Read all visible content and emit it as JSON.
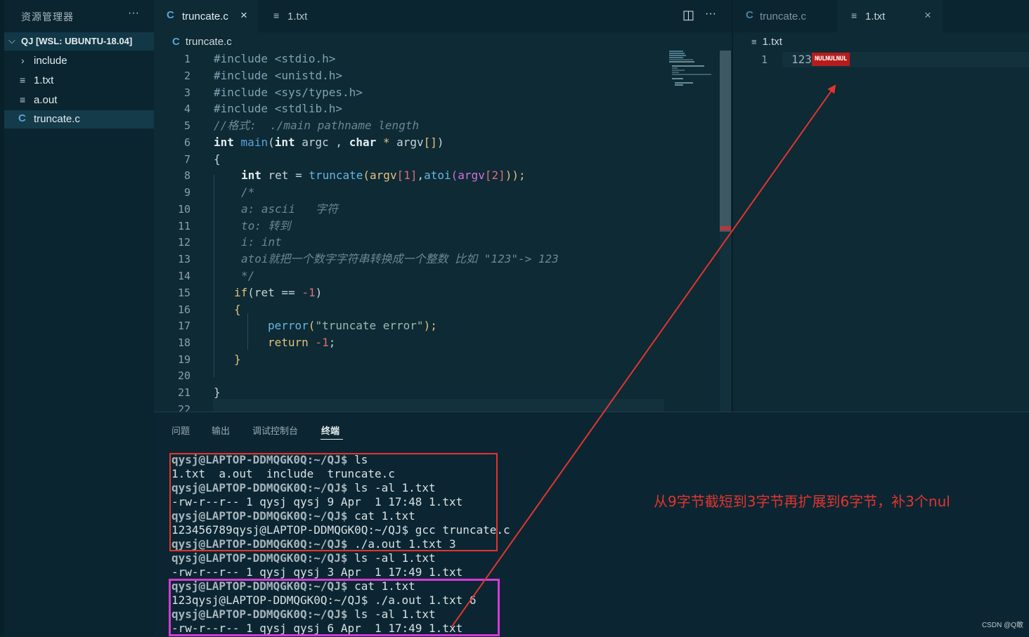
{
  "sidebar": {
    "title": "资源管理器",
    "more": "···",
    "root_label": "QJ [WSL: UBUNTU-18.04]",
    "items": [
      {
        "label": "include",
        "icon": "chevron-right-icon"
      },
      {
        "label": "1.txt",
        "icon": "file-lines-icon"
      },
      {
        "label": "a.out",
        "icon": "file-lines-icon"
      },
      {
        "label": "truncate.c",
        "icon": "c-file-icon"
      }
    ]
  },
  "left_group": {
    "tabs": [
      {
        "label": "truncate.c",
        "close": "×"
      },
      {
        "label": "1.txt"
      }
    ],
    "actions": {
      "split": "◫",
      "more": "···"
    },
    "breadcrumb": "truncate.c",
    "lines": [
      {
        "n": "1"
      },
      {
        "n": "2"
      },
      {
        "n": "3"
      },
      {
        "n": "4"
      },
      {
        "n": "5"
      },
      {
        "n": "6"
      },
      {
        "n": "7"
      },
      {
        "n": "8"
      },
      {
        "n": "9"
      },
      {
        "n": "10"
      },
      {
        "n": "11"
      },
      {
        "n": "12"
      },
      {
        "n": "13"
      },
      {
        "n": "14"
      },
      {
        "n": "15"
      },
      {
        "n": "16"
      },
      {
        "n": "17"
      },
      {
        "n": "18"
      },
      {
        "n": "19"
      },
      {
        "n": "20"
      },
      {
        "n": "21"
      },
      {
        "n": "22"
      }
    ],
    "code": {
      "l1": "#include <stdio.h>",
      "l2": "#include <unistd.h>",
      "l3": "#include <sys/types.h>",
      "l4": "#include <stdlib.h>",
      "l5": "//格式:  ./main pathname length",
      "l6a": "int",
      "l6b": "main",
      "l6c": "(",
      "l6d": "int",
      "l6e": " argc , ",
      "l6f": "char",
      "l6g": " * ",
      "l6h": "argv",
      "l6i": "[]",
      "l6j": ")",
      "l7": "{",
      "l8a": "int",
      "l8b": " ret = ",
      "l8c": "truncate",
      "l8d": "(argv",
      "l8e": "[1]",
      "l8f": ",",
      "l8g": "atoi",
      "l8h": "(argv",
      "l8i": "[2]",
      "l8j": "));",
      "l9": "/*",
      "l10": "a: ascii   字符",
      "l11": "to: 转到",
      "l12": "i: int",
      "l13": "atoi就把一个数字字符串转换成一个整数 比如 \"123\"-> 123",
      "l14": "*/",
      "l15a": "if",
      "l15b": "(ret == ",
      "l15c": "-1",
      "l15d": ")",
      "l16": "{",
      "l17a": "perror",
      "l17b": "(",
      "l17c": "\"truncate error\"",
      "l17d": ");",
      "l18a": "return",
      "l18b": " -1",
      "l18c": ";",
      "l19": "}",
      "l20": "",
      "l21": "}"
    }
  },
  "right_group": {
    "tabs": [
      {
        "label": "truncate.c"
      },
      {
        "label": "1.txt",
        "close": "×"
      }
    ],
    "breadcrumb": "1.txt",
    "line_no": "1",
    "content": "123",
    "nul_badge": "NULNULNUL"
  },
  "panel": {
    "tabs": [
      "问题",
      "输出",
      "调试控制台",
      "终端"
    ],
    "active_tab": "终端",
    "terminal": [
      {
        "prompt": "qysj@LAPTOP-DDMQGK0Q:~/QJ$",
        "text": " ls"
      },
      {
        "prompt": "",
        "text": "1.txt  a.out  include  truncate.c"
      },
      {
        "prompt": "qysj@LAPTOP-DDMQGK0Q:~/QJ$",
        "text": " ls -al 1.txt"
      },
      {
        "prompt": "",
        "text": "-rw-r--r-- 1 qysj qysj 9 Apr  1 17:48 1.txt"
      },
      {
        "prompt": "qysj@LAPTOP-DDMQGK0Q:~/QJ$",
        "text": " cat 1.txt"
      },
      {
        "prompt": "",
        "text": "123456789qysj@LAPTOP-DDMQGK0Q:~/QJ$ gcc truncate.c"
      },
      {
        "prompt": "qysj@LAPTOP-DDMQGK0Q:~/QJ$",
        "text": " ./a.out 1.txt 3"
      },
      {
        "prompt": "qysj@LAPTOP-DDMQGK0Q:~/QJ$",
        "text": " ls -al 1.txt"
      },
      {
        "prompt": "",
        "text": "-rw-r--r-- 1 qysj qysj 3 Apr  1 17:49 1.txt"
      },
      {
        "prompt": "qysj@LAPTOP-DDMQGK0Q:~/QJ$",
        "text": " cat 1.txt"
      },
      {
        "prompt": "",
        "text": "123qysj@LAPTOP-DDMQGK0Q:~/QJ$ ./a.out 1.txt 6"
      },
      {
        "prompt": "qysj@LAPTOP-DDMQGK0Q:~/QJ$",
        "text": " ls -al 1.txt"
      },
      {
        "prompt": "",
        "text": "-rw-r--r-- 1 qysj qysj 6 Apr  1 17:49 1.txt"
      }
    ]
  },
  "annotation": "从9字节截短到3字节再扩展到6字节，补3个nul",
  "watermark": "CSDN @Q敢",
  "colors": {
    "annotation": "#e3342f",
    "box_red": "#e3342f",
    "box_magenta": "#d63ad6",
    "nul_bg": "#b71c1c"
  }
}
